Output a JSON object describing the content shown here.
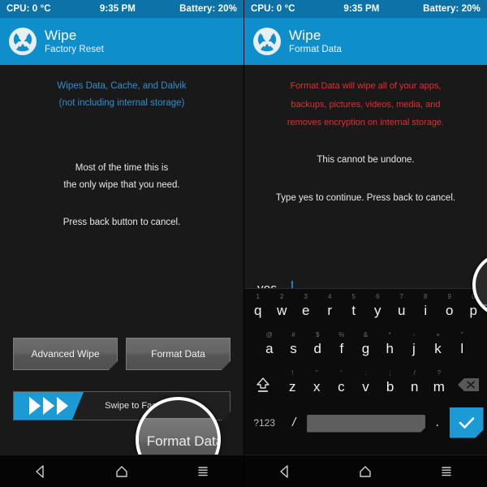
{
  "status_bar": {
    "cpu": "CPU: 0 °C",
    "time": "9:35 PM",
    "battery": "Battery: 20%"
  },
  "colors": {
    "status_bar_bg": "#0c72a8",
    "header_bg": "#0e8fcc",
    "accent_blue": "#1b9ad6",
    "link_blue": "#2e8fd0",
    "warning_red": "#e03030",
    "panel_bg": "#191919",
    "keyboard_bg": "#0c0c0c"
  },
  "left_panel": {
    "header": {
      "title": "Wipe",
      "subtitle": "Factory Reset",
      "logo_icon": "twrp-logo-icon"
    },
    "blue_note_lines": [
      "Wipes Data, Cache, and Dalvik",
      "(not including internal storage)"
    ],
    "white_note_lines_1": [
      "Most of the time this is",
      "the only wipe that you need."
    ],
    "white_note_lines_2": [
      "Press back button to cancel."
    ],
    "buttons": [
      {
        "label": "Advanced Wipe",
        "name": "advanced-wipe-button"
      },
      {
        "label": "Format Data",
        "name": "format-data-button"
      }
    ],
    "swipe": {
      "label": "Swipe to Factory Reset",
      "arrow_count": 3
    },
    "magnifier": {
      "target": "Format Data"
    }
  },
  "right_panel": {
    "header": {
      "title": "Wipe",
      "subtitle": "Format Data",
      "logo_icon": "twrp-logo-icon"
    },
    "red_note_lines": [
      "Format Data will wipe all of your apps,",
      "backups, pictures, videos, media, and",
      "removes encryption on internal storage."
    ],
    "undone_line": "This cannot be undone.",
    "type_line": "Type yes to continue.  Press back to cancel.",
    "input": {
      "value": "yes",
      "placeholder": ""
    },
    "magnifier": {
      "value": "yes"
    }
  },
  "keyboard": {
    "row1": [
      {
        "sup": "1",
        "key": "q"
      },
      {
        "sup": "2",
        "key": "w"
      },
      {
        "sup": "3",
        "key": "e"
      },
      {
        "sup": "4",
        "key": "r"
      },
      {
        "sup": "5",
        "key": "t"
      },
      {
        "sup": "6",
        "key": "y"
      },
      {
        "sup": "7",
        "key": "u"
      },
      {
        "sup": "8",
        "key": "i"
      },
      {
        "sup": "9",
        "key": "o"
      },
      {
        "sup": "0",
        "key": "p"
      }
    ],
    "row2": [
      {
        "sup": "@",
        "key": "a"
      },
      {
        "sup": "#",
        "key": "s"
      },
      {
        "sup": "$",
        "key": "d"
      },
      {
        "sup": "%",
        "key": "f"
      },
      {
        "sup": "&",
        "key": "g"
      },
      {
        "sup": "*",
        "key": "h"
      },
      {
        "sup": "-",
        "key": "j"
      },
      {
        "sup": "+",
        "key": "k"
      },
      {
        "sup": "\"",
        "key": "l"
      }
    ],
    "row3": [
      {
        "sup": "!",
        "key": "z"
      },
      {
        "sup": "\"",
        "key": "x"
      },
      {
        "sup": "'",
        "key": "c"
      },
      {
        "sup": ":",
        "key": "v"
      },
      {
        "sup": ";",
        "key": "b"
      },
      {
        "sup": "/",
        "key": "n"
      },
      {
        "sup": "?",
        "key": "m"
      }
    ],
    "shift_key": "shift-icon",
    "delete_key": "backspace-icon",
    "symbols_key": "?123",
    "slash_key": "/",
    "space_key": "",
    "period_key": ".",
    "enter_key": "checkmark-icon"
  },
  "nav_bar": {
    "back": "back-triangle-icon",
    "home": "home-pentagon-icon",
    "recent": "recent-apps-icon"
  }
}
